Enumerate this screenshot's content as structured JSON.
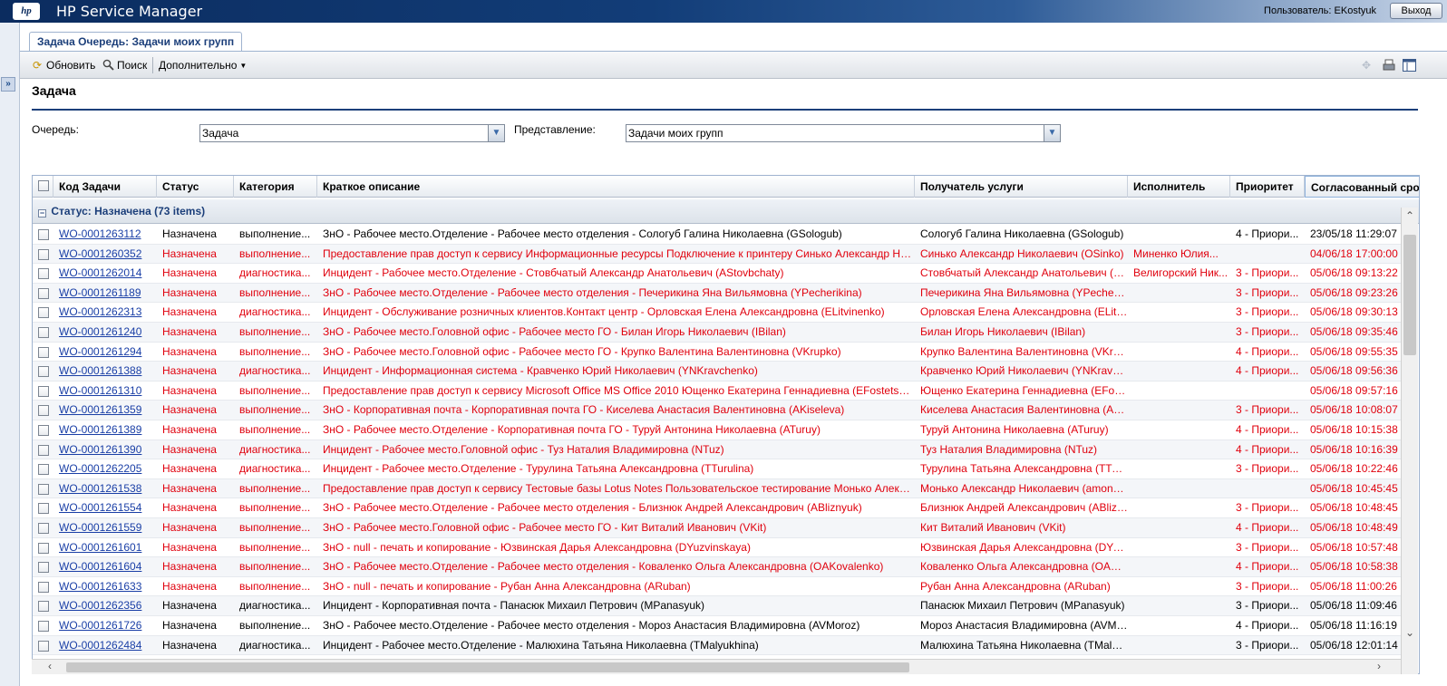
{
  "header": {
    "logo": "hp",
    "app_title": "HP Service Manager",
    "user_label": "Пользователь: EKostyuk",
    "logout_label": "Выход"
  },
  "tab": {
    "label": "Задача Очередь: Задачи моих групп"
  },
  "toolbar": {
    "refresh_label": "Обновить",
    "search_label": "Поиск",
    "more_label": "Дополнительно"
  },
  "page": {
    "title": "Задача",
    "queue_label": "Очередь:",
    "queue_value": "Задача",
    "view_label": "Представление:",
    "view_value": "Задачи моих групп"
  },
  "grid": {
    "columns": [
      "Код Задачи",
      "Статус",
      "Категория",
      "Краткое описание",
      "Получатель услуги",
      "Исполнитель",
      "Приоритет",
      "Согласованный срок"
    ],
    "group_label": "Статус: Назначена (73 items)",
    "rows": [
      {
        "id": "WO-0001263112",
        "status": "Назначена",
        "category": "выполнение...",
        "desc": "ЗнО - Рабочее место.Отделение - Рабочее место отделения - Сологуб Галина Николаевна (GSologub)",
        "recipient": "Сологуб Галина Николаевна (GSologub)",
        "assignee": "",
        "priority": "4 - Приори...",
        "deadline": "23/05/18 11:29:07",
        "red": false
      },
      {
        "id": "WO-0001260352",
        "status": "Назначена",
        "category": "выполнение...",
        "desc": "Предоставление прав доступ к сервису Информационные ресурсы Подключение к принтеру Синько Александр Никола...",
        "recipient": "Синько Александр Николаевич (OSinko)",
        "assignee": "Миненко Юлия...",
        "priority": "",
        "deadline": "04/06/18 17:00:00",
        "red": true
      },
      {
        "id": "WO-0001262014",
        "status": "Назначена",
        "category": "диагностика...",
        "desc": "Инцидент - Рабочее место.Отделение - Стовбчатый Александр Анатольевич (AStovbchaty)",
        "recipient": "Стовбчатый Александр Анатольевич (A...",
        "assignee": "Велигорский Ник...",
        "priority": "3 - Приори...",
        "deadline": "05/06/18 09:13:22",
        "red": true
      },
      {
        "id": "WO-0001261189",
        "status": "Назначена",
        "category": "выполнение...",
        "desc": "ЗнО - Рабочее место.Отделение - Рабочее место отделения - Печерикина Яна Вильямовна (YPecherikina)",
        "recipient": "Печерикина Яна Вильямовна (YPecheri...",
        "assignee": "",
        "priority": "3 - Приори...",
        "deadline": "05/06/18 09:23:26",
        "red": true
      },
      {
        "id": "WO-0001262313",
        "status": "Назначена",
        "category": "диагностика...",
        "desc": "Инцидент - Обслуживание розничных клиентов.Контакт центр - Орловская Елена Александровна (ELitvinenko)",
        "recipient": "Орловская Елена Александровна (ELitvi...",
        "assignee": "",
        "priority": "3 - Приори...",
        "deadline": "05/06/18 09:30:13",
        "red": true
      },
      {
        "id": "WO-0001261240",
        "status": "Назначена",
        "category": "выполнение...",
        "desc": "ЗнО - Рабочее место.Головной офис - Рабочее место ГО - Билан Игорь Николаевич (IBilan)",
        "recipient": "Билан Игорь Николаевич (IBilan)",
        "assignee": "",
        "priority": "3 - Приори...",
        "deadline": "05/06/18 09:35:46",
        "red": true
      },
      {
        "id": "WO-0001261294",
        "status": "Назначена",
        "category": "выполнение...",
        "desc": "ЗнО - Рабочее место.Головной офис - Рабочее место ГО - Крупко Валентина Валентиновна (VKrupko)",
        "recipient": "Крупко Валентина Валентиновна (VKru...",
        "assignee": "",
        "priority": "4 - Приори...",
        "deadline": "05/06/18 09:55:35",
        "red": true
      },
      {
        "id": "WO-0001261388",
        "status": "Назначена",
        "category": "диагностика...",
        "desc": "Инцидент - Информационная система - Кравченко Юрий Николаевич (YNKravchenko)",
        "recipient": "Кравченко Юрий Николаевич (YNKravch...",
        "assignee": "",
        "priority": "4 - Приори...",
        "deadline": "05/06/18 09:56:36",
        "red": true
      },
      {
        "id": "WO-0001261310",
        "status": "Назначена",
        "category": "выполнение...",
        "desc": "Предоставление прав доступ к сервису Microsoft Office MS Office 2010 Ющенко Екатерина Геннадиевна (EFostetskaya)",
        "recipient": "Ющенко Екатерина Геннадиевна (EFost...",
        "assignee": "",
        "priority": "",
        "deadline": "05/06/18 09:57:16",
        "red": true
      },
      {
        "id": "WO-0001261359",
        "status": "Назначена",
        "category": "выполнение...",
        "desc": "ЗнО - Корпоративная почта - Корпоративная почта ГО - Киселева Анастасия Валентиновна (AKiseleva)",
        "recipient": "Киселева Анастасия Валентиновна (AKi...",
        "assignee": "",
        "priority": "3 - Приори...",
        "deadline": "05/06/18 10:08:07",
        "red": true
      },
      {
        "id": "WO-0001261389",
        "status": "Назначена",
        "category": "выполнение...",
        "desc": "ЗнО - Рабочее место.Отделение - Корпоративная почта ГО - Туруй Антонина Николаевна (ATuruy)",
        "recipient": "Туруй Антонина Николаевна (ATuruy)",
        "assignee": "",
        "priority": "4 - Приори...",
        "deadline": "05/06/18 10:15:38",
        "red": true
      },
      {
        "id": "WO-0001261390",
        "status": "Назначена",
        "category": "диагностика...",
        "desc": "Инцидент - Рабочее место.Головной офис - Туз Наталия Владимировна (NTuz)",
        "recipient": "Туз Наталия Владимировна (NTuz)",
        "assignee": "",
        "priority": "4 - Приори...",
        "deadline": "05/06/18 10:16:39",
        "red": true
      },
      {
        "id": "WO-0001262205",
        "status": "Назначена",
        "category": "диагностика...",
        "desc": "Инцидент - Рабочее место.Отделение - Турулина Татьяна Александровна (TTurulina)",
        "recipient": "Турулина Татьяна Александровна (TTur...",
        "assignee": "",
        "priority": "3 - Приори...",
        "deadline": "05/06/18 10:22:46",
        "red": true
      },
      {
        "id": "WO-0001261538",
        "status": "Назначена",
        "category": "выполнение...",
        "desc": "Предоставление прав доступ к сервису Тестовые базы Lotus Notes Пользовательское тестирование Монько Александр...",
        "recipient": "Монько Александр Николаевич (amonko)",
        "assignee": "",
        "priority": "",
        "deadline": "05/06/18 10:45:45",
        "red": true
      },
      {
        "id": "WO-0001261554",
        "status": "Назначена",
        "category": "выполнение...",
        "desc": "ЗнО - Рабочее место.Отделение - Рабочее место отделения - Близнюк Андрей Александрович (ABliznyuk)",
        "recipient": "Близнюк Андрей Александрович (ABlizn...",
        "assignee": "",
        "priority": "3 - Приори...",
        "deadline": "05/06/18 10:48:45",
        "red": true
      },
      {
        "id": "WO-0001261559",
        "status": "Назначена",
        "category": "выполнение...",
        "desc": "ЗнО - Рабочее место.Головной офис - Рабочее место ГО - Кит Виталий Иванович (VKit)",
        "recipient": "Кит Виталий Иванович (VKit)",
        "assignee": "",
        "priority": "4 - Приори...",
        "deadline": "05/06/18 10:48:49",
        "red": true
      },
      {
        "id": "WO-0001261601",
        "status": "Назначена",
        "category": "выполнение...",
        "desc": "ЗнО - null - печать и копирование - Юзвинская Дарья Александровна (DYuzvinskaya)",
        "recipient": "Юзвинская Дарья Александровна (DYuz...",
        "assignee": "",
        "priority": "3 - Приори...",
        "deadline": "05/06/18 10:57:48",
        "red": true
      },
      {
        "id": "WO-0001261604",
        "status": "Назначена",
        "category": "выполнение...",
        "desc": "ЗнО - Рабочее место.Отделение - Рабочее место отделения - Коваленко Ольга Александровна (OAKovalenko)",
        "recipient": "Коваленко Ольга Александровна (OAKo...",
        "assignee": "",
        "priority": "4 - Приори...",
        "deadline": "05/06/18 10:58:38",
        "red": true
      },
      {
        "id": "WO-0001261633",
        "status": "Назначена",
        "category": "выполнение...",
        "desc": "ЗнО - null - печать и копирование - Рубан Анна Александровна (ARuban)",
        "recipient": "Рубан Анна Александровна (ARuban)",
        "assignee": "",
        "priority": "3 - Приори...",
        "deadline": "05/06/18 11:00:26",
        "red": true
      },
      {
        "id": "WO-0001262356",
        "status": "Назначена",
        "category": "диагностика...",
        "desc": "Инцидент - Корпоративная почта - Панасюк Михаил Петрович (MPanasyuk)",
        "recipient": "Панасюк Михаил Петрович (MPanasyuk)",
        "assignee": "",
        "priority": "3 - Приори...",
        "deadline": "05/06/18 11:09:46",
        "red": false
      },
      {
        "id": "WO-0001261726",
        "status": "Назначена",
        "category": "выполнение...",
        "desc": "ЗнО - Рабочее место.Отделение - Рабочее место отделения - Мороз Анастасия Владимировна (AVMoroz)",
        "recipient": "Мороз Анастасия Владимировна (AVMo...",
        "assignee": "",
        "priority": "4 - Приори...",
        "deadline": "05/06/18 11:16:19",
        "red": false
      },
      {
        "id": "WO-0001262484",
        "status": "Назначена",
        "category": "диагностика...",
        "desc": "Инцидент - Рабочее место.Отделение - Малюхина Татьяна Николаевна (TMalyukhina)",
        "recipient": "Малюхина Татьяна Николаевна (TMalyu...",
        "assignee": "",
        "priority": "3 - Приори...",
        "deadline": "05/06/18 12:01:14",
        "red": false
      }
    ]
  }
}
